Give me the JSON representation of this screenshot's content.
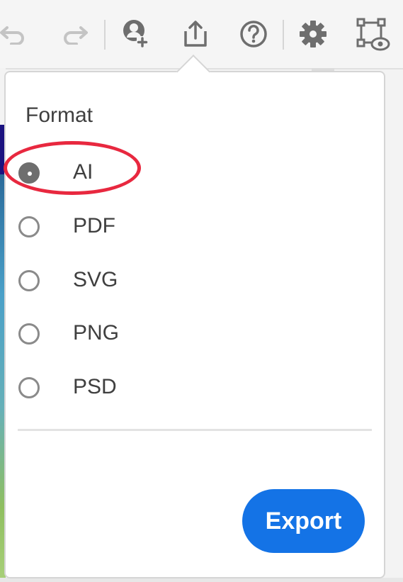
{
  "toolbar": {
    "icons": {
      "undo": "undo-icon",
      "redo": "redo-icon",
      "invite": "invite-user-icon",
      "share": "share-export-icon",
      "help": "help-icon",
      "settings": "gear-icon",
      "preview": "artboard-preview-icon"
    }
  },
  "export_panel": {
    "format_label": "Format",
    "options": [
      {
        "label": "AI",
        "selected": true
      },
      {
        "label": "PDF",
        "selected": false
      },
      {
        "label": "SVG",
        "selected": false
      },
      {
        "label": "PNG",
        "selected": false
      },
      {
        "label": "PSD",
        "selected": false
      }
    ],
    "export_button": "Export"
  },
  "colors": {
    "accent": "#1473e6",
    "highlight": "#e8283f",
    "icon_gray": "#6e6e6e",
    "text": "#3f3f3f"
  }
}
